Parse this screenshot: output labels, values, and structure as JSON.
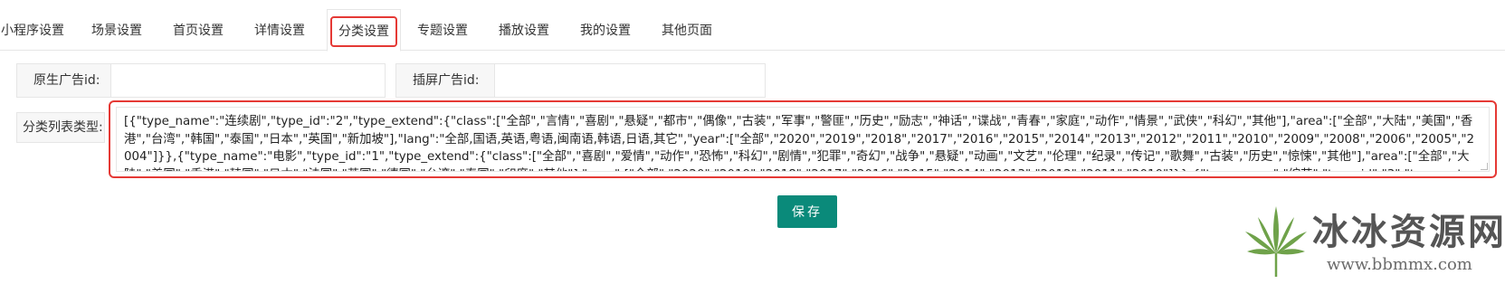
{
  "tabs": [
    {
      "label": "小程序设置",
      "active": false
    },
    {
      "label": "场景设置",
      "active": false
    },
    {
      "label": "首页设置",
      "active": false
    },
    {
      "label": "详情设置",
      "active": false
    },
    {
      "label": "分类设置",
      "active": true
    },
    {
      "label": "专题设置",
      "active": false
    },
    {
      "label": "播放设置",
      "active": false
    },
    {
      "label": "我的设置",
      "active": false
    },
    {
      "label": "其他页面",
      "active": false
    }
  ],
  "form": {
    "native_ad": {
      "label": "原生广告id:",
      "value": ""
    },
    "interstitial_ad": {
      "label": "插屏广告id:",
      "value": ""
    },
    "category_list": {
      "label": "分类列表类型:",
      "value": "[{\"type_name\":\"连续剧\",\"type_id\":\"2\",\"type_extend\":{\"class\":[\"全部\",\"言情\",\"喜剧\",\"悬疑\",\"都市\",\"偶像\",\"古装\",\"军事\",\"警匪\",\"历史\",\"励志\",\"神话\",\"谍战\",\"青春\",\"家庭\",\"动作\",\"情景\",\"武侠\",\"科幻\",\"其他\"],\"area\":[\"全部\",\"大陆\",\"美国\",\"香港\",\"台湾\",\"韩国\",\"泰国\",\"日本\",\"英国\",\"新加坡\"],\"lang\":\"全部,国语,英语,粤语,闽南语,韩语,日语,其它\",\"year\":[\"全部\",\"2020\",\"2019\",\"2018\",\"2017\",\"2016\",\"2015\",\"2014\",\"2013\",\"2012\",\"2011\",\"2010\",\"2009\",\"2008\",\"2006\",\"2005\",\"2004\"]}},{\"type_name\":\"电影\",\"type_id\":\"1\",\"type_extend\":{\"class\":[\"全部\",\"喜剧\",\"爱情\",\"动作\",\"恐怖\",\"科幻\",\"剧情\",\"犯罪\",\"奇幻\",\"战争\",\"悬疑\",\"动画\",\"文艺\",\"伦理\",\"纪录\",\"传记\",\"歌舞\",\"古装\",\"历史\",\"惊悚\",\"其他\"],\"area\":[\"全部\",\"大陆\",\"美国\",\"香港\",\"韩国\",\"日本\",\"法国\",\"英国\",\"德国\",\"台湾\",\"泰国\",\"印度\",\"其他\"],\"year\":[\"全部\",\"2020\",\"2019\",\"2018\",\"2017\",\"2016\",\"2015\",\"2014\",\"2013\",\"2012\",\"2011\",\"2010\"]}},{\"type_name\":\"综艺\",\"type_id\":\"3\",\"type_extend\":{\"class\":[\"全部\",\"选秀\",\"情感\",\"访谈\",\"播报\",\"旅游\",\"音乐\",\"美食\",\"纪实\",\"曲艺\",\"生活\",\"游戏互动\",\"财经\",\"求职\",\"其他\"],\"area\":[\"全部\",\"内地\",\"港台\",\"日韩\",\"欧美\",\"其他\"],\"year\":[\"全"
    }
  },
  "save_button": {
    "label": "保存"
  },
  "watermark": {
    "text": "冰冰资源网",
    "url": "www.bbmmx.com"
  },
  "colors": {
    "highlight": "#e53935",
    "primary": "#0a8a7a",
    "label_bg": "#f7f7f7",
    "border": "#e6e6e6"
  }
}
